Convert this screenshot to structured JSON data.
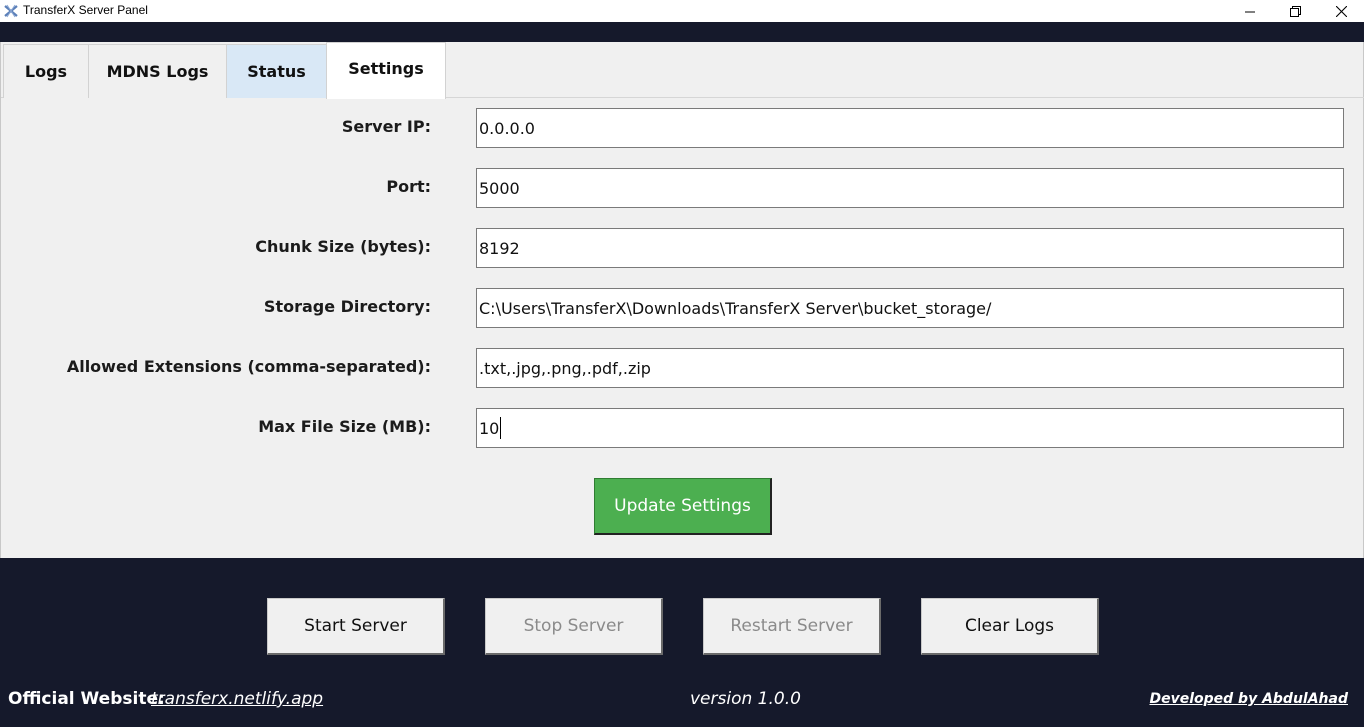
{
  "window": {
    "title": "TransferX Server Panel",
    "icon": "transferx-logo-icon",
    "controls": [
      "minimize-icon",
      "restore-icon",
      "close-icon"
    ]
  },
  "tabs": [
    {
      "label": "Logs",
      "selected": false
    },
    {
      "label": "MDNS Logs",
      "selected": false
    },
    {
      "label": "Status",
      "selected": false
    },
    {
      "label": "Settings",
      "selected": true
    }
  ],
  "settings": {
    "server_ip": {
      "label": "Server IP:",
      "value": "0.0.0.0"
    },
    "port": {
      "label": "Port:",
      "value": "5000"
    },
    "chunk_size": {
      "label": "Chunk Size (bytes):",
      "value": "8192"
    },
    "storage_directory": {
      "label": "Storage Directory:",
      "value": "C:\\Users\\TransferX\\Downloads\\TransferX Server\\bucket_storage/"
    },
    "allowed_extensions": {
      "label": "Allowed Extensions (comma-separated):",
      "value": ".txt,.jpg,.png,.pdf,.zip"
    },
    "max_file_size": {
      "label": "Max File Size (MB):",
      "value": "10"
    },
    "update_button": "Update Settings"
  },
  "controls": {
    "start": "Start Server",
    "stop": "Stop Server",
    "restart": "Restart Server",
    "clear": "Clear Logs"
  },
  "footer": {
    "website_label": "Official Website:",
    "website_link": "transferx.netlify.app",
    "version": "version 1.0.0",
    "developer": "Developed by AbdulAhad"
  },
  "colors": {
    "background": "#15192b",
    "panel": "#f0f0f0",
    "accent_green": "#4caf50",
    "status_tab": "#d9e8f6"
  }
}
